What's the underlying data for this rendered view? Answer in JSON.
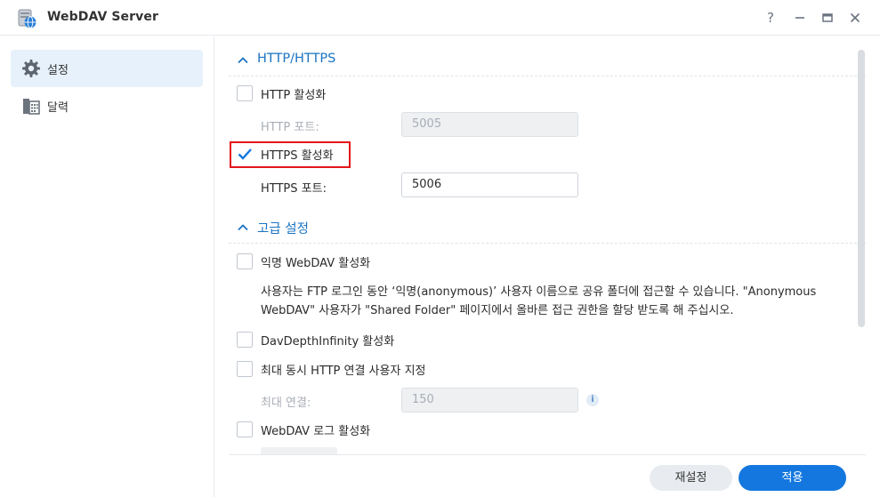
{
  "window": {
    "title": "WebDAV Server",
    "icon": "webdav-server-icon",
    "controls": {
      "help": "?",
      "minimize": "—",
      "maximize": "▭",
      "close": "✕"
    }
  },
  "sidebar": {
    "items": [
      {
        "label": "설정",
        "icon": "gear-icon",
        "active": true
      },
      {
        "label": "달력",
        "icon": "calendar-icon",
        "active": false
      }
    ]
  },
  "sections": {
    "http": {
      "title": "HTTP/HTTPS",
      "enable_http": {
        "label": "HTTP 활성화",
        "checked": false
      },
      "http_port": {
        "label": "HTTP 포트:",
        "value": "5005",
        "disabled": true
      },
      "enable_https": {
        "label": "HTTPS 활성화",
        "checked": true
      },
      "https_port": {
        "label": "HTTPS 포트:",
        "value": "5006",
        "disabled": false
      }
    },
    "advanced": {
      "title": "고급 설정",
      "anonymous": {
        "label": "익명 WebDAV 활성화",
        "checked": false,
        "description_line1": "사용자는 FTP 로그인 동안 ‘익명(anonymous)’ 사용자 이름으로 공유 폴더에 접근할 수 있습니다. \"Anonymous",
        "description_line2": "WebDAV\" 사용자가 \"Shared Folder\" 페이지에서 올바른 접근 권한을 할당 받도록 해 주십시오."
      },
      "depth_infinity": {
        "label": "DavDepthInfinity 활성화",
        "checked": false
      },
      "max_connections_toggle": {
        "label": "최대 동시 HTTP 연결 사용자 지정",
        "checked": false
      },
      "max_connections": {
        "label": "최대 연결:",
        "value": "150",
        "disabled": true,
        "info_icon": "info-icon"
      },
      "log": {
        "label": "WebDAV 로그 활성화",
        "checked": false
      }
    }
  },
  "footer": {
    "reset_label": "재설정",
    "apply_label": "적용"
  },
  "colors": {
    "accent": "#1477df",
    "section_title": "#1a73c2",
    "highlight": "#e3161b",
    "sidebar_active": "#e7f1fb"
  }
}
